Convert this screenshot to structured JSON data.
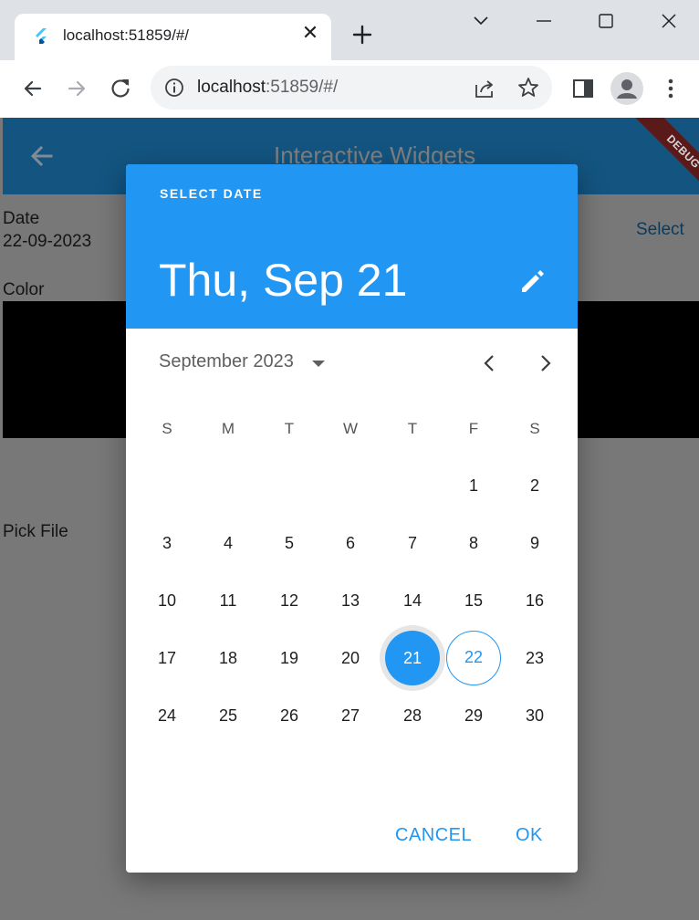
{
  "browser": {
    "tab_title": "localhost:51859/#/",
    "close_glyph": "✕",
    "url_host": "localhost",
    "url_rest": ":51859/#/"
  },
  "app": {
    "title": "Interactive Widgets",
    "debug_banner": "DEBUG",
    "date_label": "Date",
    "date_value": "22-09-2023",
    "select_label": "Select",
    "color_label": "Color",
    "pick_file_label": "Pick File",
    "color_value": "#000000"
  },
  "date_picker": {
    "help_text": "SELECT DATE",
    "selected_text": "Thu, Sep 21",
    "month_label": "September 2023",
    "weekdays": [
      "S",
      "M",
      "T",
      "W",
      "T",
      "F",
      "S"
    ],
    "weeks": [
      [
        "",
        "",
        "",
        "",
        "",
        "1",
        "2"
      ],
      [
        "3",
        "4",
        "5",
        "6",
        "7",
        "8",
        "9"
      ],
      [
        "10",
        "11",
        "12",
        "13",
        "14",
        "15",
        "16"
      ],
      [
        "17",
        "18",
        "19",
        "20",
        "21",
        "22",
        "23"
      ],
      [
        "24",
        "25",
        "26",
        "27",
        "28",
        "29",
        "30"
      ]
    ],
    "selected_day": "21",
    "today_day": "22",
    "cancel_label": "CANCEL",
    "ok_label": "OK",
    "accent_color": "#2196f3"
  },
  "icons": {
    "favicon": "flutter-icon",
    "newtab": "plus-icon",
    "back": "arrow-left-icon",
    "forward": "arrow-right-icon",
    "reload": "reload-icon",
    "site_info": "info-icon",
    "share": "share-icon",
    "bookmark": "star-icon",
    "sidepanel": "side-panel-icon",
    "profile": "profile-icon",
    "menu": "kebab-menu-icon",
    "edit": "pencil-icon"
  }
}
